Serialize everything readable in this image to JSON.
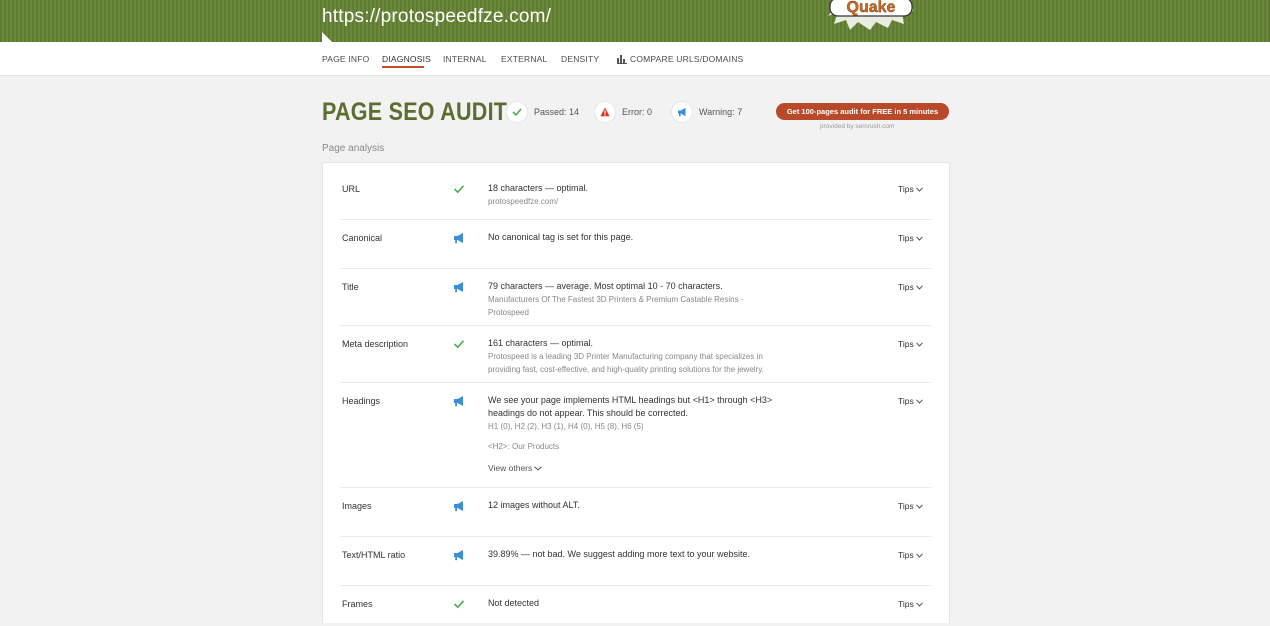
{
  "header": {
    "url": "https://protospeedfze.com/",
    "logo_text": "Quake"
  },
  "nav": {
    "items": [
      {
        "label": "PAGE INFO"
      },
      {
        "label": "DIAGNOSIS"
      },
      {
        "label": "INTERNAL"
      },
      {
        "label": "EXTERNAL"
      },
      {
        "label": "DENSITY"
      },
      {
        "label": "COMPARE URLS/DOMAINS",
        "icon": "bar-chart-icon"
      }
    ],
    "active": "DIAGNOSIS"
  },
  "audit": {
    "title": "PAGE SEO AUDIT",
    "passed_label": "Passed:",
    "passed": "14",
    "error_label": "Error:",
    "error": "0",
    "warning_label": "Warning:",
    "warning": "7",
    "cta": "Get 100-pages audit for FREE in 5 minutes",
    "provided_by": "provided by  semrush.com",
    "section_label": "Page analysis"
  },
  "colors": {
    "header_green": "#62803a",
    "title_green": "#5a6e31",
    "accent_orange": "#c0522b",
    "cta_red": "#b8492a",
    "passed_check": "#4caf50",
    "error_red": "#d9352a",
    "warning_blue": "#3a8fd6"
  },
  "rows": [
    {
      "name": "URL",
      "status": "passed",
      "main": "18 characters — optimal.",
      "sub": [
        "protospeedfze.com/"
      ],
      "tips": "Tips"
    },
    {
      "name": "Canonical",
      "status": "warning",
      "main": "No canonical tag is set for this page.",
      "sub": [],
      "tips": "Tips"
    },
    {
      "name": "Title",
      "status": "warning",
      "main": "79 characters — average. Most optimal 10 - 70 characters.",
      "sub": [
        "Manufacturers Of The Fastest 3D Printers & Premium Castable Resins -",
        "Protospeed"
      ],
      "tips": "Tips"
    },
    {
      "name": "Meta description",
      "status": "passed",
      "main": "161 characters — optimal.",
      "sub": [
        "Protospeed is a leading 3D Printer Manufacturing company that specializes in",
        "providing fast, cost-effective, and high-quality printing solutions for the jewelry."
      ],
      "tips": "Tips"
    },
    {
      "name": "Headings",
      "status": "warning",
      "main": "We see your page implements HTML headings but <H1> through <H3> headings do not appear. This should be corrected.",
      "sub": [
        "H1 (0), H2 (2), H3 (1), H4 (0), H5 (8), H6 (5)"
      ],
      "extra": "<H2>: Our Products",
      "view_others": "View others",
      "tips": "Tips"
    },
    {
      "name": "Images",
      "status": "warning",
      "main": "12 images without ALT.",
      "sub": [],
      "tips": "Tips"
    },
    {
      "name": "Text/HTML ratio",
      "status": "warning",
      "main": "39.89% — not bad. We suggest adding more text to your website.",
      "sub": [],
      "tips": "Tips"
    },
    {
      "name": "Frames",
      "status": "passed",
      "main": "Not detected",
      "sub": [],
      "tips": "Tips"
    }
  ]
}
